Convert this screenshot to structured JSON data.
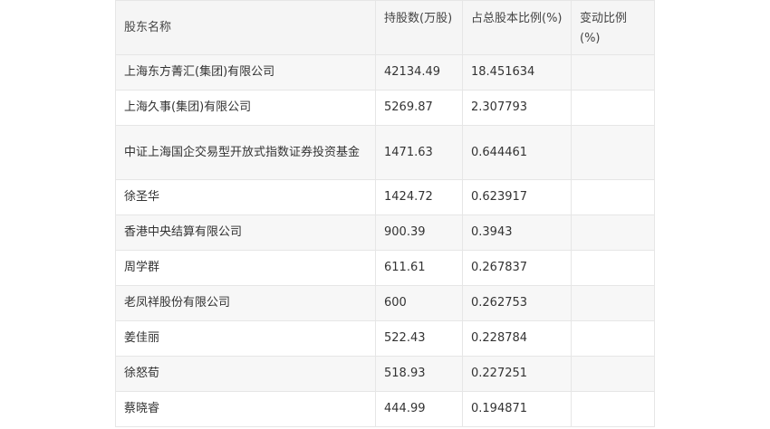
{
  "table": {
    "headers": {
      "name": "股东名称",
      "shares": "持股数(万股)",
      "ratio": "占总股本比例(%)",
      "change": "变动比例(%)"
    },
    "rows": [
      {
        "name": "上海东方菁汇(集团)有限公司",
        "shares": "42134.49",
        "ratio": "18.451634",
        "change": ""
      },
      {
        "name": "上海久事(集团)有限公司",
        "shares": "5269.87",
        "ratio": "2.307793",
        "change": ""
      },
      {
        "name": "中证上海国企交易型开放式指数证券投资基金",
        "shares": "1471.63",
        "ratio": "0.644461",
        "change": ""
      },
      {
        "name": "徐圣华",
        "shares": "1424.72",
        "ratio": "0.623917",
        "change": ""
      },
      {
        "name": "香港中央结算有限公司",
        "shares": "900.39",
        "ratio": "0.3943",
        "change": ""
      },
      {
        "name": "周学群",
        "shares": "611.61",
        "ratio": "0.267837",
        "change": ""
      },
      {
        "name": "老凤祥股份有限公司",
        "shares": "600",
        "ratio": "0.262753",
        "change": ""
      },
      {
        "name": "姜佳丽",
        "shares": "522.43",
        "ratio": "0.228784",
        "change": ""
      },
      {
        "name": "徐怒荀",
        "shares": "518.93",
        "ratio": "0.227251",
        "change": ""
      },
      {
        "name": "蔡晓睿",
        "shares": "444.99",
        "ratio": "0.194871",
        "change": ""
      }
    ]
  }
}
